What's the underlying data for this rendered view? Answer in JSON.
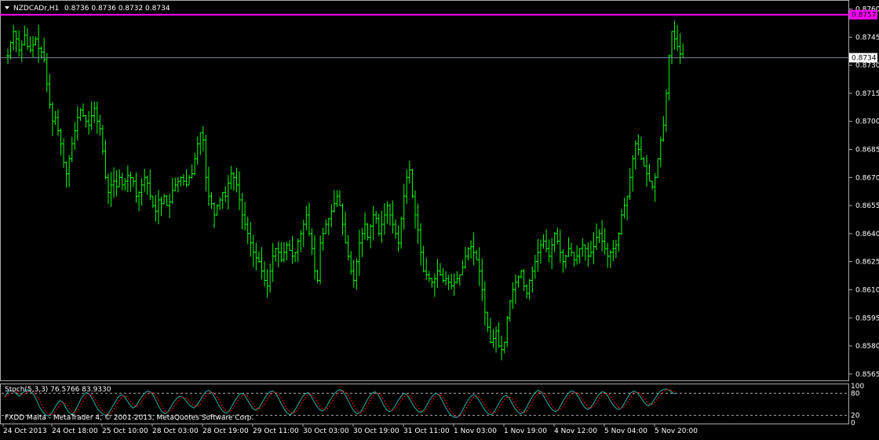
{
  "header": {
    "symbol": "NZDCADr,H1",
    "ohlc": "0.8736 0.8736 0.8732 0.8734"
  },
  "indicator": {
    "label": "Stoch(5,3,3) 76.5766 83.9330",
    "levels": [
      80,
      20
    ],
    "scale_labels": [
      "100",
      "80",
      "20",
      "0"
    ]
  },
  "copyright": "FXDD Malta - MetaTrader 4, © 2001-2013, MetaQuotes Software Corp.",
  "colors": {
    "background": "#000000",
    "candle": "#00ff00",
    "resistance_line": "#ff00ff",
    "bid_line": "#778899",
    "stoch_main": "#20b2aa",
    "stoch_signal": "#ff0000"
  },
  "chart_data": {
    "type": "line",
    "title": "",
    "ylim": [
      0.8562,
      0.8764
    ],
    "yticks": [
      "0.8760",
      "0.8745",
      "0.8730",
      "0.8715",
      "0.8700",
      "0.8685",
      "0.8670",
      "0.8655",
      "0.8640",
      "0.8625",
      "0.8610",
      "0.8595",
      "0.8580",
      "0.8565"
    ],
    "xticks": [
      "24 Oct 2013",
      "24 Oct 18:00",
      "25 Oct 10:00",
      "28 Oct 03:00",
      "28 Oct 19:00",
      "29 Oct 11:00",
      "30 Oct 03:00",
      "30 Oct 19:00",
      "31 Oct 11:00",
      "1 Nov 03:00",
      "1 Nov 19:00",
      "4 Nov 12:00",
      "5 Nov 04:00",
      "5 Nov 20:00"
    ],
    "resistance_level": "0.8757",
    "current_price": "0.8734",
    "series": [
      {
        "values": [
          0.8735,
          0.8742,
          0.8748,
          0.8744,
          0.8738,
          0.8741,
          0.8746,
          0.874,
          0.8738,
          0.8741,
          0.8744,
          0.8739,
          0.8737,
          0.8733,
          0.872,
          0.8709,
          0.87,
          0.8702,
          0.8695,
          0.8688,
          0.8678,
          0.8672,
          0.868,
          0.8688,
          0.8695,
          0.8702,
          0.8706,
          0.8703,
          0.87,
          0.8698,
          0.8703,
          0.8707,
          0.87,
          0.8696,
          0.8684,
          0.867,
          0.8662,
          0.8666,
          0.8668,
          0.8665,
          0.867,
          0.8666,
          0.8668,
          0.8671,
          0.867,
          0.8668,
          0.866,
          0.8662,
          0.8666,
          0.867,
          0.8667,
          0.866,
          0.8655,
          0.8652,
          0.8658,
          0.8656,
          0.866,
          0.8655,
          0.8657,
          0.8663,
          0.8666,
          0.8668,
          0.867,
          0.8668,
          0.8666,
          0.867,
          0.8672,
          0.868,
          0.8688,
          0.8694,
          0.869,
          0.867,
          0.866,
          0.8656,
          0.865,
          0.8655,
          0.8658,
          0.8662,
          0.866,
          0.8667,
          0.8672,
          0.867,
          0.8666,
          0.8658,
          0.865,
          0.8645,
          0.864,
          0.8635,
          0.863,
          0.8627,
          0.8625,
          0.862,
          0.8615,
          0.8612,
          0.862,
          0.8628,
          0.8632,
          0.863,
          0.8626,
          0.863,
          0.8634,
          0.8631,
          0.8628,
          0.863,
          0.8636,
          0.864,
          0.8645,
          0.865,
          0.864,
          0.8632,
          0.862,
          0.8615,
          0.8635,
          0.864,
          0.8645,
          0.8648,
          0.8652,
          0.8656,
          0.866,
          0.8655,
          0.8645,
          0.8635,
          0.8628,
          0.862,
          0.8615,
          0.8625,
          0.8635,
          0.864,
          0.8645,
          0.8638,
          0.8644,
          0.865,
          0.8648,
          0.864,
          0.8645,
          0.865,
          0.8655,
          0.865,
          0.8645,
          0.864,
          0.8635,
          0.8648,
          0.866,
          0.867,
          0.8674,
          0.866,
          0.865,
          0.8642,
          0.863,
          0.862,
          0.8618,
          0.8616,
          0.8614,
          0.8616,
          0.862,
          0.8618,
          0.8615,
          0.8616,
          0.8614,
          0.8612,
          0.8614,
          0.8616,
          0.8618,
          0.8622,
          0.8628,
          0.8632,
          0.8633,
          0.863,
          0.8626,
          0.862,
          0.861,
          0.8598,
          0.859,
          0.8582,
          0.8584,
          0.8588,
          0.858,
          0.8578,
          0.8582,
          0.8595,
          0.8604,
          0.861,
          0.8614,
          0.8617,
          0.862,
          0.8612,
          0.8608,
          0.8615,
          0.862,
          0.8625,
          0.863,
          0.8634,
          0.8636,
          0.8632,
          0.8628,
          0.8634,
          0.864,
          0.8636,
          0.863,
          0.8625,
          0.8628,
          0.8632,
          0.863,
          0.8626,
          0.8628,
          0.8632,
          0.8634,
          0.8632,
          0.8628,
          0.863,
          0.8633,
          0.8638,
          0.864,
          0.8636,
          0.8632,
          0.8628,
          0.863,
          0.8632,
          0.8634,
          0.864,
          0.865,
          0.8655,
          0.866,
          0.867,
          0.868,
          0.8688,
          0.8685,
          0.868,
          0.8676,
          0.8672,
          0.8668,
          0.8665,
          0.867,
          0.868,
          0.869,
          0.8698,
          0.8715,
          0.8735,
          0.8748,
          0.8744,
          0.874,
          0.8736,
          0.8734
        ]
      }
    ],
    "stochastic": {
      "values": [
        70,
        82,
        88,
        85,
        78,
        72,
        80,
        86,
        90,
        84,
        76,
        60,
        42,
        30,
        22,
        18,
        25,
        38,
        52,
        60,
        55,
        40,
        28,
        22,
        30,
        45,
        62,
        75,
        82,
        78,
        66,
        50,
        36,
        28,
        22,
        20,
        30,
        44,
        58,
        70,
        76,
        72,
        60,
        48,
        40,
        45,
        58,
        70,
        80,
        86,
        84,
        74,
        58,
        42,
        30,
        24,
        30,
        42,
        56,
        66,
        72,
        70,
        62,
        52,
        44,
        40,
        48,
        60,
        74,
        84,
        88,
        82,
        70,
        54,
        40,
        30,
        26,
        32,
        46,
        60,
        72,
        80,
        78,
        66,
        52,
        40,
        34,
        38,
        50,
        64,
        76,
        84,
        86,
        80,
        66,
        50,
        36,
        26,
        22,
        28,
        40,
        54,
        68,
        78,
        82,
        74,
        60,
        46,
        36,
        32,
        38,
        52,
        66,
        78,
        86,
        90,
        86,
        74,
        58,
        42,
        30,
        24,
        28,
        40,
        56,
        70,
        80,
        84,
        78,
        64,
        48,
        36,
        30,
        34,
        46,
        60,
        72,
        80,
        76,
        64,
        50,
        38,
        30,
        28,
        36,
        50,
        64,
        74,
        80,
        76,
        62,
        46,
        32,
        22,
        16,
        14,
        20,
        32,
        48,
        62,
        72,
        76,
        70,
        58,
        44,
        32,
        24,
        22,
        30,
        44,
        58,
        70,
        74,
        68,
        54,
        40,
        30,
        24,
        28,
        40,
        56,
        70,
        82,
        88,
        84,
        72,
        58,
        44,
        34,
        30,
        36,
        50,
        64,
        76,
        84,
        86,
        80,
        68,
        54,
        42,
        36,
        40,
        52,
        66,
        78,
        84,
        82,
        72,
        58,
        46,
        38,
        36,
        44,
        58,
        72,
        82,
        86,
        82,
        72,
        60,
        50,
        46,
        52,
        64,
        76,
        86,
        90,
        92,
        88,
        82,
        78
      ]
    }
  }
}
